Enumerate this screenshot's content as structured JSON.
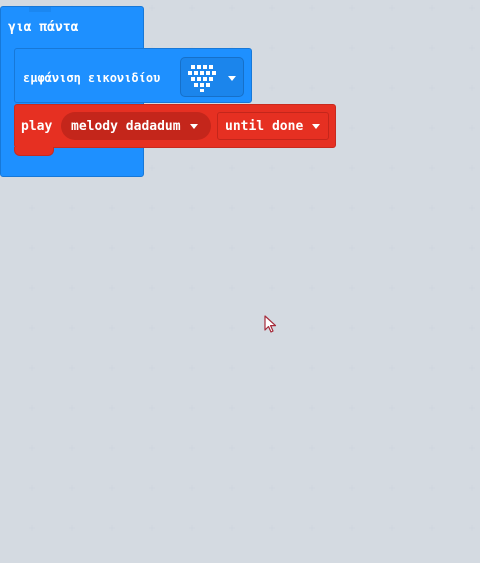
{
  "workspace": {
    "forever_block": {
      "label": "για πάντα",
      "color": "#1e90ff"
    },
    "show_icon_block": {
      "label": "εμφάνιση εικονιδίου",
      "icon": "heart-icon",
      "color": "#1e90ff"
    },
    "play_block": {
      "label": "play",
      "melody_value": "melody dadadum",
      "mode_value": "until done",
      "color": "#e63022"
    }
  }
}
